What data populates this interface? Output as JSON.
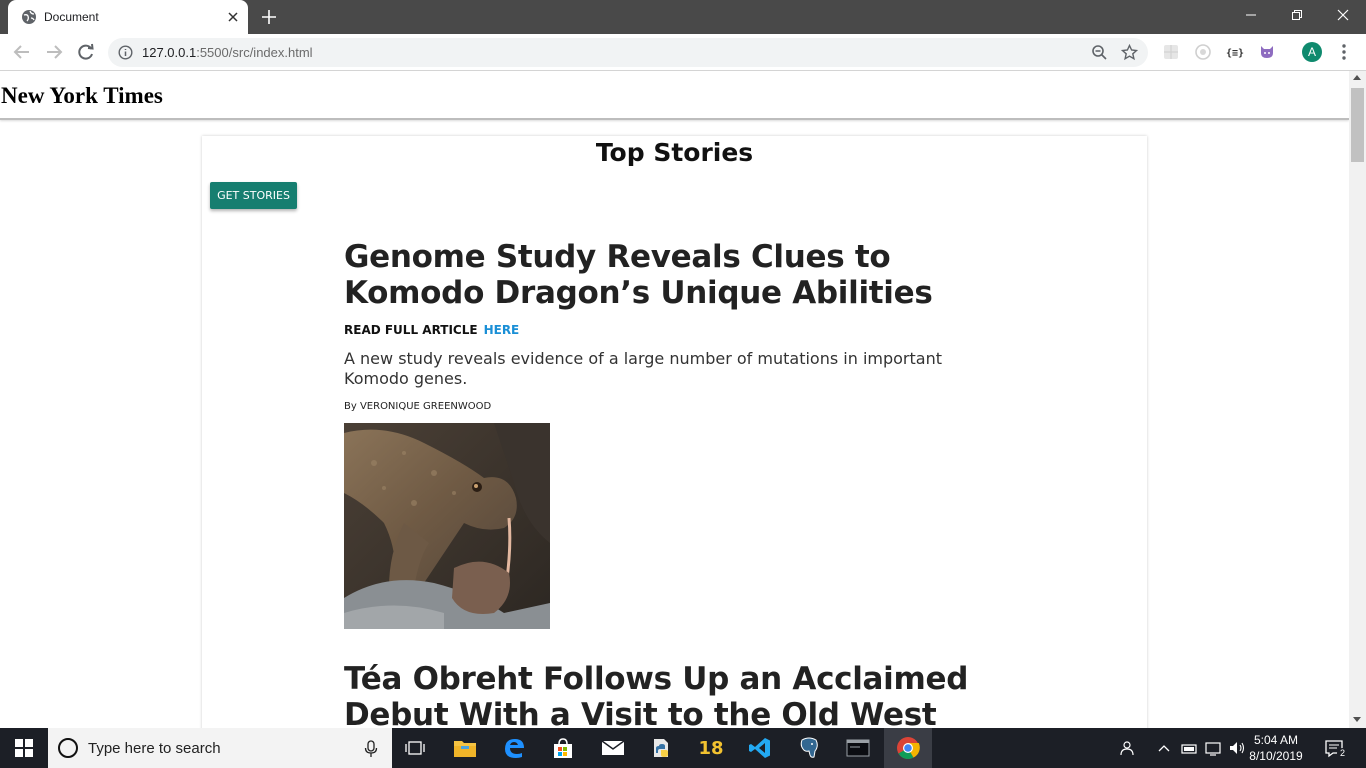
{
  "browser": {
    "tab_title": "Document",
    "url_host": "127.0.0.1",
    "url_rest": ":5500/src/index.html",
    "avatar_letter": "A"
  },
  "site": {
    "title": "New York Times"
  },
  "card": {
    "title": "Top Stories",
    "get_button": "GET STORIES"
  },
  "articles": [
    {
      "headline": "Genome Study Reveals Clues to Komodo Dragon’s Unique Abilities",
      "read_label": "READ FULL ARTICLE",
      "link_label": "HERE",
      "abstract": "A new study reveals evidence of a large number of mutations in important Komodo genes.",
      "byline": "By VERONIQUE GREENWOOD"
    },
    {
      "headline": "Téa Obreht Follows Up an Acclaimed Debut With a Visit to the Old West"
    }
  ],
  "taskbar": {
    "search_placeholder": "Type here to search",
    "app_badge": "18",
    "time": "5:04 AM",
    "date": "8/10/2019",
    "notification_count": "2"
  },
  "colors": {
    "accent_button": "#167e70",
    "link": "#1a8fd6",
    "tab_strip": "#494949",
    "taskbar": "#1c1f26"
  }
}
